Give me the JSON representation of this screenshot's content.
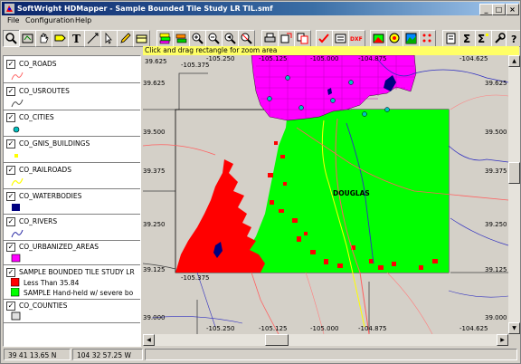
{
  "window": {
    "title": "SoftWright HDMapper - Sample Bounded Tile Study LR TIL.smf"
  },
  "menu": [
    "File",
    "Configuration",
    "Help"
  ],
  "hint": "Click and drag rectangle for zoom area",
  "legend": [
    {
      "label": "CO_ROADS",
      "checked": true
    },
    {
      "label": "CO_USROUTES",
      "checked": true
    },
    {
      "label": "CO_CITIES",
      "checked": true
    },
    {
      "label": "CO_GNIS_BUILDINGS",
      "checked": true
    },
    {
      "label": "CO_RAILROADS",
      "checked": true
    },
    {
      "label": "CO_WATERBODIES",
      "checked": true
    },
    {
      "label": "CO_RIVERS",
      "checked": true
    },
    {
      "label": "CO_URBANIZED_AREAS",
      "checked": true
    },
    {
      "label": "SAMPLE BOUNDED TILE STUDY LR",
      "checked": true
    },
    {
      "label": "CO_COUNTIES",
      "checked": true
    }
  ],
  "legend_sub": [
    "Less Than 35.84",
    "SAMPLE Hand-held w/ severe bo"
  ],
  "map": {
    "top_ticks": [
      "-105.250",
      "-105.125",
      "-105.000",
      "-104.875",
      "-104.625"
    ],
    "top_left_tick": "-105.375",
    "bottom_ticks": [
      "-105.250",
      "-105.125",
      "-105.000",
      "-104.875",
      "-104.625"
    ],
    "bottom_left_tick": "-105.375",
    "left_ticks": [
      "39.625",
      "39.500",
      "39.375",
      "39.250",
      "39.125",
      "39.000"
    ],
    "right_ticks": [
      "39.625",
      "39.500",
      "39.375",
      "39.250",
      "39.125",
      "39.000"
    ],
    "place_label": "DOUGLAS"
  },
  "status": {
    "lat": "39 41 13.65 N",
    "lon": "104 32 57.25 W"
  },
  "colors": {
    "urban": "#ff00ff",
    "green": "#00ff00",
    "red": "#ff0000",
    "water": "#000080",
    "map_bg": "#d4d0c8"
  }
}
